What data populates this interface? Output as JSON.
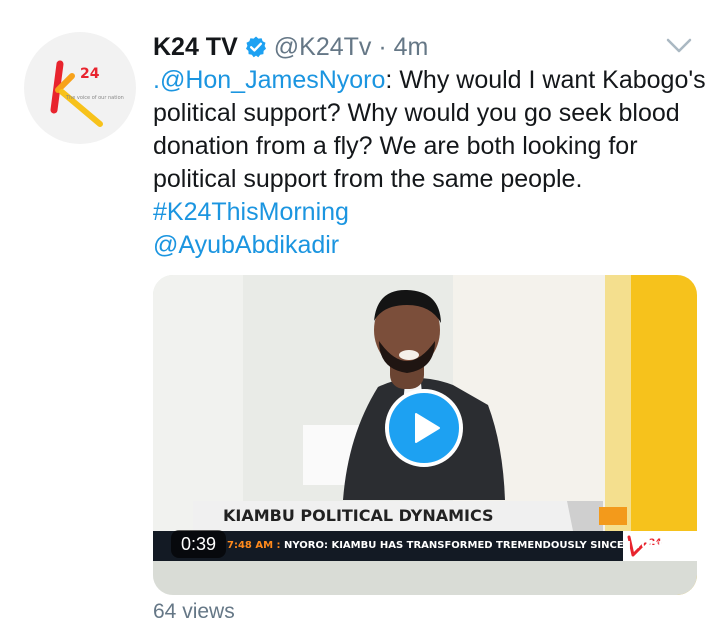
{
  "tweet": {
    "author_name": "K24 TV",
    "handle": "@K24Tv",
    "separator": "·",
    "time": "4m",
    "avatar_logo_text": "24",
    "avatar_tagline": "The voice of our nation",
    "text_mention": ".@Hon_JamesNyoro",
    "text_line1_rest": ": Why would I want Kabogo's",
    "text_line2": "political support? Why would you go seek blood",
    "text_line3": "donation from a fly? We are both looking for",
    "text_line4": "political support from the same people.",
    "hashtag": "#K24ThisMorning",
    "mention2": "@AyubAbdikadir",
    "views": "64 views"
  },
  "video": {
    "duration": "0:39",
    "banner_title": "KIAMBU POLITICAL DYNAMICS",
    "ticker_time": "7:48 AM :",
    "ticker_text": "NYORO: KIAMBU HAS TRANSFORMED TREMENDOUSLY SINCE I TOOK OVER",
    "channel_logo_text": "24"
  },
  "colors": {
    "link": "#1b95e0",
    "verified": "#1da1f2",
    "play_button": "#1da1f2",
    "brand_orange": "#f39a1b"
  },
  "icons": [
    "verified-badge-icon",
    "chevron-down-icon",
    "play-icon"
  ]
}
